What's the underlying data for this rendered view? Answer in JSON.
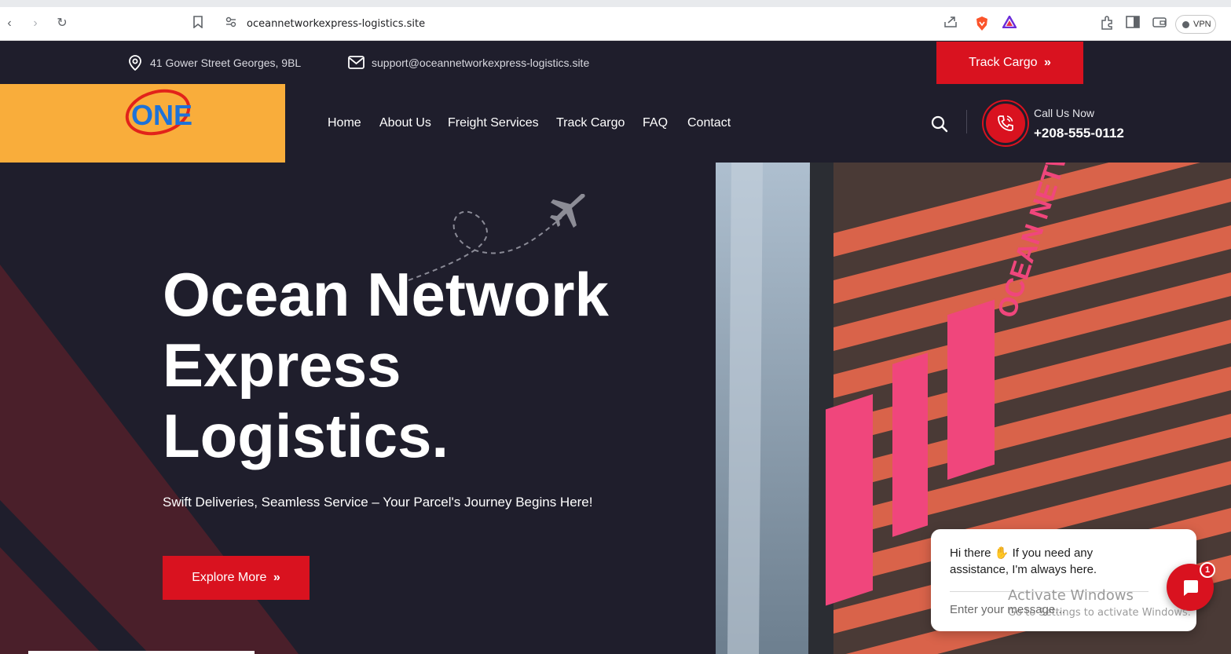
{
  "browser": {
    "url": "oceannetworkexpress-logistics.site",
    "vpn_label": "VPN"
  },
  "topbar": {
    "address": "41 Gower Street Georges, 9BL",
    "email": "support@oceannetworkexpress-logistics.site",
    "track_button": "Track Cargo"
  },
  "header": {
    "logo_text": "ONE",
    "menu": [
      "Home",
      "About Us",
      "Freight Services",
      "Track Cargo",
      "FAQ",
      "Contact"
    ],
    "call_label": "Call Us Now",
    "call_number": "+208-555-0112"
  },
  "hero": {
    "title_line1": "Ocean Network",
    "title_line2": "Express",
    "title_line3": "Logistics.",
    "subtitle": "Swift Deliveries, Seamless Service – Your Parcel's Journey Begins Here!",
    "button": "Explore More",
    "sign_text": "OCEAN NETWORK EXPRESS"
  },
  "chat": {
    "message_part1": "Hi there",
    "message_part2": "If you need any assistance, I'm always here.",
    "placeholder": "Enter your message...",
    "badge": "1"
  },
  "watermark": {
    "line1": "Activate Windows",
    "line2": "Go to Settings to activate Windows."
  },
  "colors": {
    "brand_red": "#d9121f",
    "dark_navy": "#1f1e2c",
    "logo_orange": "#f9ad3b",
    "sign_pink": "#f0467c"
  }
}
